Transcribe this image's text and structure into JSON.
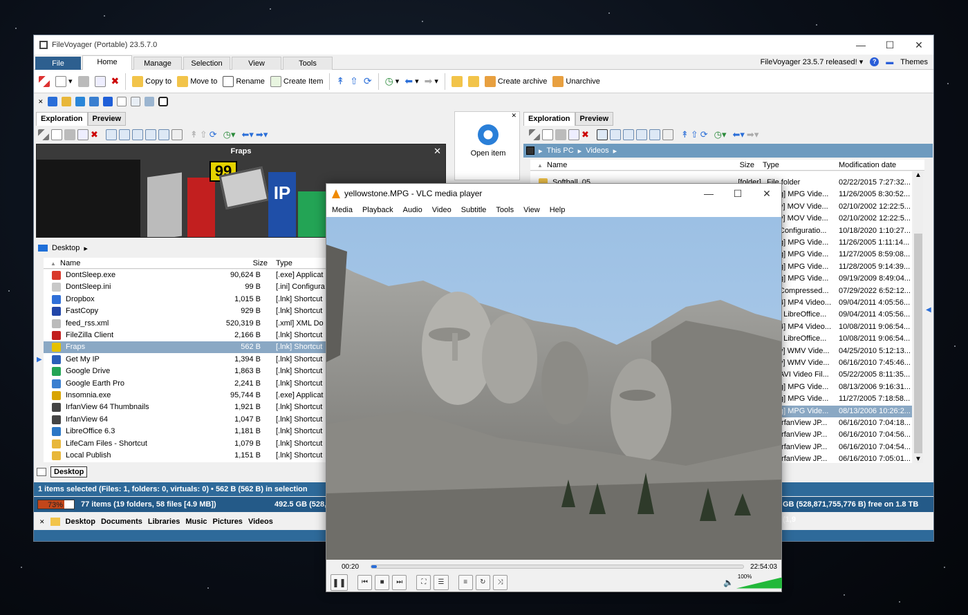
{
  "filevoyager": {
    "title": "FileVoyager (Portable) 23.5.7.0",
    "tabs": [
      "File",
      "Home",
      "Manage",
      "Selection",
      "View",
      "Tools"
    ],
    "release_notice": "FileVoyager 23.5.7 released!",
    "themes": "Themes",
    "ribbon": {
      "copy_to": "Copy to",
      "move_to": "Move to",
      "rename": "Rename",
      "create_item": "Create Item",
      "create_archive": "Create archive",
      "unarchive": "Unarchive"
    },
    "left": {
      "tabs": [
        "Exploration",
        "Preview"
      ],
      "preview_title": "Fraps",
      "breadcrumb": "Desktop",
      "columns": {
        "name": "Name",
        "size": "Size",
        "type": "Type"
      },
      "rows": [
        {
          "name": "DontSleep.exe",
          "size": "90,624 B",
          "type": "[.exe]  Applicat",
          "color": "#d9392b"
        },
        {
          "name": "DontSleep.ini",
          "size": "99 B",
          "type": "[.ini]  Configura",
          "color": "#c8c8c8"
        },
        {
          "name": "Dropbox",
          "size": "1,015 B",
          "type": "[.lnk]  Shortcut",
          "color": "#2f6fd8"
        },
        {
          "name": "FastCopy",
          "size": "929 B",
          "type": "[.lnk]  Shortcut",
          "color": "#2246a8"
        },
        {
          "name": "feed_rss.xml",
          "size": "520,319 B",
          "type": "[.xml]  XML Do",
          "color": "#bbbbbb"
        },
        {
          "name": "FileZilla Client",
          "size": "2,166 B",
          "type": "[.lnk]  Shortcut",
          "color": "#c21f1f"
        },
        {
          "name": "Fraps",
          "size": "562 B",
          "type": "[.lnk]  Shortcut",
          "color": "#e5c100"
        },
        {
          "name": "Get My IP",
          "size": "1,394 B",
          "type": "[.lnk]  Shortcut",
          "color": "#2a5fb8"
        },
        {
          "name": "Google Drive",
          "size": "1,863 B",
          "type": "[.lnk]  Shortcut",
          "color": "#23a455"
        },
        {
          "name": "Google Earth Pro",
          "size": "2,241 B",
          "type": "[.lnk]  Shortcut",
          "color": "#3a7fd0"
        },
        {
          "name": "Insomnia.exe",
          "size": "95,744 B",
          "type": "[.exe]  Applicat",
          "color": "#d8a400"
        },
        {
          "name": "IrfanView 64 Thumbnails",
          "size": "1,921 B",
          "type": "[.lnk]  Shortcut",
          "color": "#444444"
        },
        {
          "name": "IrfanView 64",
          "size": "1,047 B",
          "type": "[.lnk]  Shortcut",
          "color": "#444444"
        },
        {
          "name": "LibreOffice 6.3",
          "size": "1,181 B",
          "type": "[.lnk]  Shortcut",
          "color": "#2c77c5"
        },
        {
          "name": "LifeCam Files - Shortcut",
          "size": "1,079 B",
          "type": "[.lnk]  Shortcut",
          "color": "#e8b73a"
        },
        {
          "name": "Local Publish",
          "size": "1,151 B",
          "type": "[.lnk]  Shortcut",
          "color": "#e8b73a"
        }
      ],
      "bottom_tab": "Desktop"
    },
    "middle": {
      "open_item": "Open item"
    },
    "right": {
      "tabs": [
        "Exploration",
        "Preview"
      ],
      "breadcrumb": [
        "This PC",
        "Videos"
      ],
      "columns": {
        "name": "Name",
        "size": "Size",
        "type": "Type",
        "modified": "Modification date"
      },
      "first_rows": [
        {
          "name": "Softball_05",
          "size": "[folder]",
          "type": "File folder",
          "date": "02/22/2015 7:27:32..."
        }
      ],
      "rows": [
        {
          "type": "g]  MPG Vide...",
          "date": "11/26/2005 8:30:52..."
        },
        {
          "type": "v]  MOV Vide...",
          "date": "02/10/2002 12:22:5..."
        },
        {
          "type": "v]  MOV Vide...",
          "date": "02/10/2002 12:22:5..."
        },
        {
          "type": "Configuratio...",
          "date": "10/18/2020 1:10:27..."
        },
        {
          "type": "g]  MPG Vide...",
          "date": "11/26/2005 1:11:14..."
        },
        {
          "type": "g]  MPG Vide...",
          "date": "11/27/2005 8:59:08..."
        },
        {
          "type": "g]  MPG Vide...",
          "date": "11/28/2005 9:14:39..."
        },
        {
          "type": "g]  MPG Vide...",
          "date": "09/19/2009 8:49:04..."
        },
        {
          "type": "Compressed...",
          "date": "07/29/2022 6:52:12..."
        },
        {
          "type": "4]  MP4 Video...",
          "date": "09/04/2011 4:05:56..."
        },
        {
          "type": "]  LibreOffice...",
          "date": "09/04/2011 4:05:56..."
        },
        {
          "type": "4]  MP4 Video...",
          "date": "10/08/2011 9:06:54..."
        },
        {
          "type": "]  LibreOffice...",
          "date": "10/08/2011 9:06:54..."
        },
        {
          "type": "v]  WMV Vide...",
          "date": "04/25/2010 5:12:13..."
        },
        {
          "type": "v]  WMV Vide...",
          "date": "06/16/2010 7:45:46..."
        },
        {
          "type": "AVI Video Fil...",
          "date": "05/22/2005 8:11:35..."
        },
        {
          "type": "g]  MPG Vide...",
          "date": "08/13/2006 9:16:31..."
        },
        {
          "type": "g]  MPG Vide...",
          "date": "11/27/2005 7:18:58..."
        },
        {
          "type": "g]  MPG Vide...",
          "date": "08/13/2006 10:26:2..."
        },
        {
          "type": "IrfanView JP...",
          "date": "06/16/2010 7:04:18..."
        },
        {
          "type": "IrfanView JP...",
          "date": "06/16/2010 7:04:56..."
        },
        {
          "type": "IrfanView JP...",
          "date": "06/16/2010 7:04:54..."
        },
        {
          "type": "IrfanView JP...",
          "date": "06/16/2010 7:05:01..."
        }
      ]
    },
    "status_selection": "1 items selected (Files: 1, folders: 0, virtuals: 0) • 562 B (562 B) in selection",
    "status_disk_percent": "73%",
    "status_items": "77 items (19 folders, 58 files [4.9 MB])",
    "status_free_left": "492.5 GB (528,",
    "status_free_right": "GB (528,871,755,776 B) free on 1.8 TB (1,9",
    "quick_links": [
      "Desktop",
      "Documents",
      "Libraries",
      "Music",
      "Pictures",
      "Videos"
    ]
  },
  "vlc": {
    "title": "yellowstone.MPG - VLC media player",
    "menu": [
      "Media",
      "Playback",
      "Audio",
      "Video",
      "Subtitle",
      "Tools",
      "View",
      "Help"
    ],
    "time_elapsed": "00:20",
    "time_total": "22:54:03",
    "progress": 0.015,
    "volume": "100%",
    "volume_level": 1.0
  }
}
